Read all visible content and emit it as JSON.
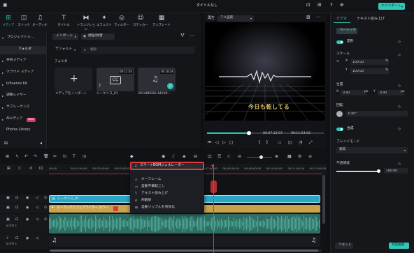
{
  "window": {
    "title": "タイトルなし",
    "export_label": "エクスポート"
  },
  "toolbar": {
    "items": [
      {
        "label": "メディア",
        "icon": "media-icon"
      },
      {
        "label": "ストック",
        "icon": "stock-icon"
      },
      {
        "label": "オーディオ",
        "icon": "music-icon"
      },
      {
        "label": "タイトル",
        "icon": "title-icon"
      },
      {
        "label": "トランジション",
        "icon": "transition-icon"
      },
      {
        "label": "エフェクト",
        "icon": "effect-icon"
      },
      {
        "label": "フィルター",
        "icon": "filter-icon"
      },
      {
        "label": "ステッカー",
        "icon": "sticker-icon"
      },
      {
        "label": "テンプレート",
        "icon": "template-icon"
      }
    ]
  },
  "sidebar": {
    "items": [
      "プロジェクトメ…",
      "フォルダ",
      "共有メディア",
      "クラウド メディア",
      "Influence Kit",
      "調整レイヤー",
      "サブシーケンス",
      "AIメディア",
      "Photos Library"
    ],
    "ai_badge": "NEW"
  },
  "media": {
    "import_label": "インポート",
    "record_label": "録画/録音",
    "sort_label": "デフォルト",
    "search_placeholder": "検索",
    "folder_label": "フォルダ",
    "items": [
      {
        "label": "メディアをインポート"
      },
      {
        "label": "シーケンス_01",
        "duration": "00:11:54"
      },
      {
        "label": "391486166-44100…",
        "duration": "00:18:38"
      }
    ]
  },
  "preview": {
    "tab_label": "再生",
    "quality": "フル品質",
    "caption": "今日も乾してる",
    "current_time": "00:07:12:07",
    "total_time": "00:11:54:02",
    "progress": 0.36
  },
  "props": {
    "tabs": [
      "ビデオ",
      "テキスト読み上げ"
    ],
    "subtab": "ベーシック",
    "transform_label": "変形",
    "scale_label": "スケール",
    "scale_x_label": "X",
    "scale_x": "100.00",
    "scale_y_label": "Y",
    "scale_y": "100.00",
    "scale_unit": "%",
    "position_label": "位置",
    "pos_x_label": "X",
    "pos_x": "0.00",
    "pos_y_label": "Y",
    "pos_y": "0.00",
    "pos_unit": "px",
    "rotate_label": "回転",
    "rotate": "0.00°",
    "composite_label": "合成",
    "blend_label": "ブレンドモード",
    "blend_value": "通常",
    "opacity_label": "不透明度",
    "opacity": "100.00",
    "opacity_level": 0.97,
    "reset_label": "リセット",
    "advanced_label": "高度編集"
  },
  "timeline": {
    "ruler": [
      "00:00",
      "00:01:00:00",
      "00:02:00:00",
      "00:03:00:00",
      "00:04:00:00",
      "00:05:00:00",
      "00:06:00:00",
      "00:07:00:00",
      "00:08:00:00",
      "00:09:00:00",
      "00:10:00:00",
      "00:11:00:00",
      "00:12:00:00"
    ],
    "video_clip": "シーケンス_01",
    "audio_clip": "オーディオビジュアライザー:カラー",
    "track_label_video": "ビデオ 1",
    "track_label_audio": "ビデオ 1"
  },
  "context_menu": {
    "title": "スマートBGMジェネレーター",
    "items": [
      "キーフレーム",
      "自動字幕起こし",
      "テキスト読み上げ",
      "AI翻訳",
      "自動リップルを有効化"
    ]
  },
  "colors": {
    "accent": "#2fc7b6",
    "highlight": "#e0383e",
    "audio_clip": "#c9a34a",
    "video_clip": "#2aa6c4",
    "wave": "#3e8f82"
  }
}
